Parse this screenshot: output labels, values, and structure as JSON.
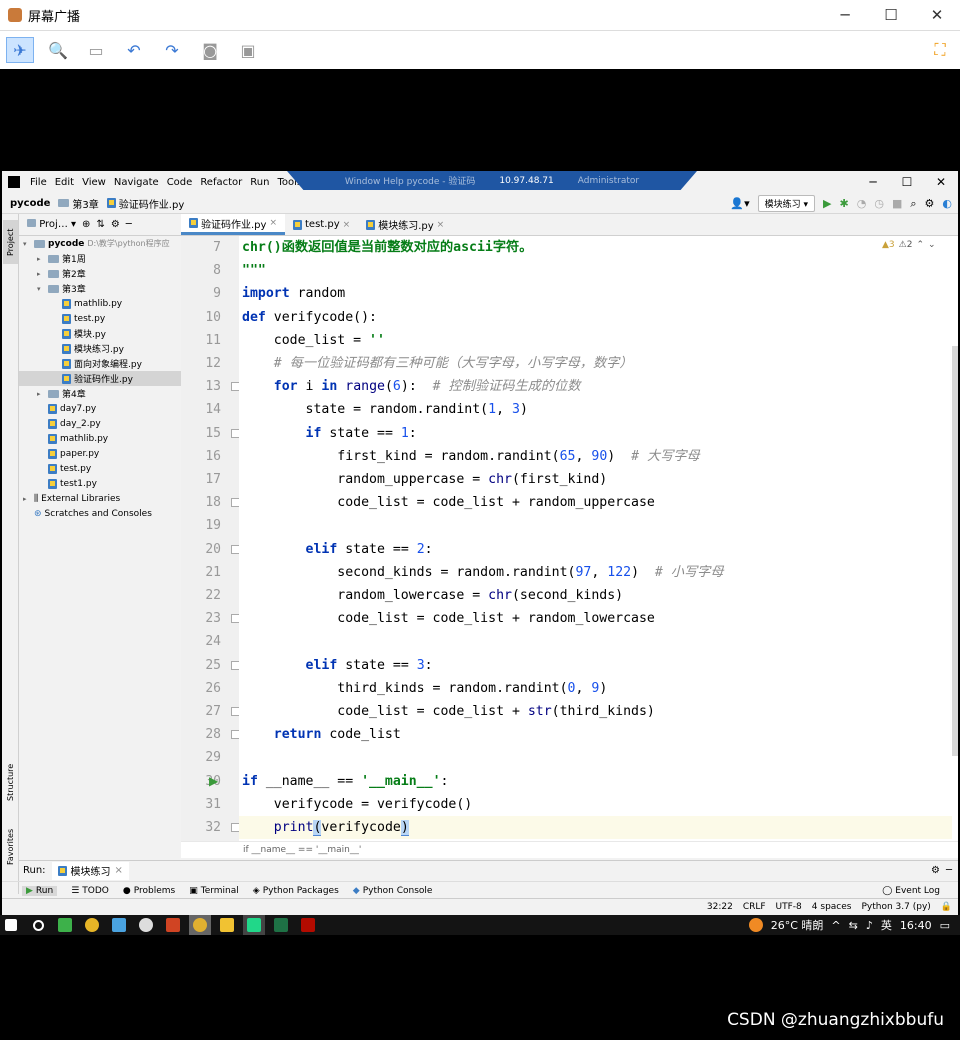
{
  "outer": {
    "title": "屏幕广播",
    "controls": {
      "minimize": "─",
      "maximize": "☐",
      "close": "✕"
    }
  },
  "ide": {
    "menu": [
      "File",
      "Edit",
      "View",
      "Navigate",
      "Code",
      "Refactor",
      "Run",
      "Tools"
    ],
    "rdp_bar": {
      "left": "Window  Help   pycode - 验证码",
      "ip": "10.97.48.71",
      "right": "Administrator"
    },
    "breadcrumb": [
      "pycode",
      "第3章",
      "验证码作业.py"
    ],
    "run_config": "模块练习 ▾",
    "window_controls": {
      "minimize": "─",
      "maximize": "☐",
      "close": "✕"
    },
    "project_header": "Proj…",
    "tree": [
      {
        "label": "pycode",
        "extra": "D:\\教学\\python程序应",
        "level": 0,
        "type": "folder",
        "expanded": true
      },
      {
        "label": "第1周",
        "level": 1,
        "type": "folder",
        "expanded": false
      },
      {
        "label": "第2章",
        "level": 1,
        "type": "folder",
        "expanded": false
      },
      {
        "label": "第3章",
        "level": 1,
        "type": "folder",
        "expanded": true
      },
      {
        "label": "mathlib.py",
        "level": 2,
        "type": "py"
      },
      {
        "label": "test.py",
        "level": 2,
        "type": "py"
      },
      {
        "label": "模块.py",
        "level": 2,
        "type": "py"
      },
      {
        "label": "模块练习.py",
        "level": 2,
        "type": "py"
      },
      {
        "label": "面向对象编程.py",
        "level": 2,
        "type": "py"
      },
      {
        "label": "验证码作业.py",
        "level": 2,
        "type": "py",
        "selected": true
      },
      {
        "label": "第4章",
        "level": 1,
        "type": "folder",
        "expanded": false
      },
      {
        "label": "day7.py",
        "level": 1,
        "type": "py"
      },
      {
        "label": "day_2.py",
        "level": 1,
        "type": "py"
      },
      {
        "label": "mathlib.py",
        "level": 1,
        "type": "py"
      },
      {
        "label": "paper.py",
        "level": 1,
        "type": "py"
      },
      {
        "label": "test.py",
        "level": 1,
        "type": "py"
      },
      {
        "label": "test1.py",
        "level": 1,
        "type": "py"
      },
      {
        "label": "External Libraries",
        "level": 0,
        "type": "lib",
        "expanded": false
      },
      {
        "label": "Scratches and Consoles",
        "level": 0,
        "type": "scratch"
      }
    ],
    "tabs": [
      {
        "label": "验证码作业.py",
        "active": true
      },
      {
        "label": "test.py",
        "active": false
      },
      {
        "label": "模块练习.py",
        "active": false
      }
    ],
    "tab_close": "×",
    "inspections": {
      "warnings": "▲3",
      "weak": "⚠2"
    },
    "line_numbers": [
      "7",
      "8",
      "9",
      "10",
      "11",
      "12",
      "13",
      "14",
      "15",
      "16",
      "17",
      "18",
      "19",
      "20",
      "21",
      "22",
      "23",
      "24",
      "25",
      "26",
      "27",
      "28",
      "29",
      "30",
      "31",
      "32"
    ],
    "code_breadcrumb": "if __name__ == '__main__'",
    "side_tabs": {
      "project": "Project",
      "structure": "Structure",
      "favorites": "Favorites"
    },
    "run_panel": {
      "label": "Run:",
      "tab": "模块练习"
    },
    "bottom_tools": [
      "Run",
      "TODO",
      "Problems",
      "Terminal",
      "Python Packages",
      "Python Console"
    ],
    "event_log": "Event Log",
    "status": [
      "32:22",
      "CRLF",
      "UTF-8",
      "4 spaces",
      "Python 3.7 (py)"
    ]
  },
  "taskbar": {
    "weather": "26°C 晴朗",
    "ime": "英",
    "time": "16:40"
  },
  "watermark": "CSDN @zhuangzhixbbufu"
}
